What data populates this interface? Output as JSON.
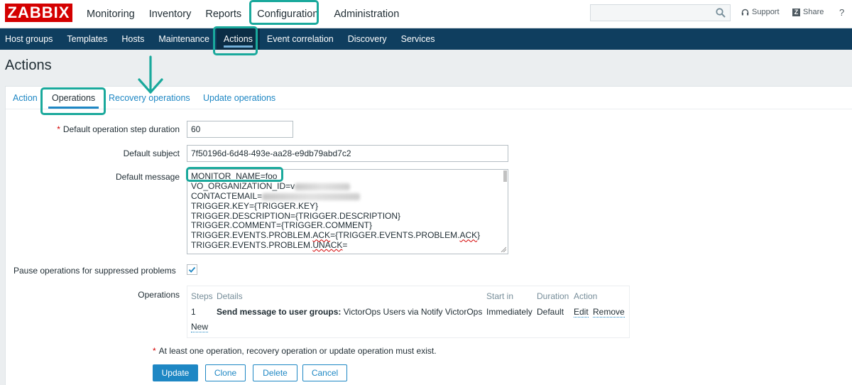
{
  "app": {
    "logo": "ZABBIX"
  },
  "topnav": {
    "items": [
      {
        "label": "Monitoring"
      },
      {
        "label": "Inventory"
      },
      {
        "label": "Reports"
      },
      {
        "label": "Configuration"
      },
      {
        "label": "Administration"
      }
    ],
    "active": "Configuration",
    "search_value": "",
    "support": "Support",
    "share": "Share",
    "help": "?"
  },
  "subnav": {
    "items": [
      {
        "label": "Host groups"
      },
      {
        "label": "Templates"
      },
      {
        "label": "Hosts"
      },
      {
        "label": "Maintenance"
      },
      {
        "label": "Actions"
      },
      {
        "label": "Event correlation"
      },
      {
        "label": "Discovery"
      },
      {
        "label": "Services"
      }
    ],
    "active": "Actions"
  },
  "page": {
    "title": "Actions"
  },
  "tabs": [
    {
      "label": "Action"
    },
    {
      "label": "Operations"
    },
    {
      "label": "Recovery operations"
    },
    {
      "label": "Update operations"
    }
  ],
  "form": {
    "step_duration_label": "Default operation step duration",
    "step_duration_value": "60",
    "subject_label": "Default subject",
    "subject_value": "7f50196d-6d48-493e-aa28-e9db79abd7c2",
    "message_label": "Default message",
    "message_lines": [
      "MONITOR_NAME=foo",
      "VO_ORGANIZATION_ID=v",
      "CONTACTEMAIL=",
      "TRIGGER.KEY={TRIGGER.KEY}",
      "TRIGGER.DESCRIPTION={TRIGGER.DESCRIPTION}",
      "TRIGGER.COMMENT={TRIGGER.COMMENT}",
      "TRIGGER.EVENTS.PROBLEM.ACK={TRIGGER.EVENTS.PROBLEM.ACK}",
      "TRIGGER.EVENTS.PROBLEM.UNACK="
    ],
    "pause_label": "Pause operations for suppressed problems",
    "pause_checked": true,
    "operations_label": "Operations"
  },
  "operations_table": {
    "headers": {
      "steps": "Steps",
      "details": "Details",
      "start_in": "Start in",
      "duration": "Duration",
      "action": "Action"
    },
    "row": {
      "step": "1",
      "details_bold": "Send message to user groups:",
      "details_rest": "VictorOps Users via Notify VictorOps",
      "start_in": "Immediately",
      "duration": "Default",
      "edit": "Edit",
      "remove": "Remove"
    },
    "new_link": "New"
  },
  "note": {
    "star": "*",
    "text": "At least one operation, recovery operation or update operation must exist."
  },
  "buttons": {
    "update": "Update",
    "clone": "Clone",
    "delete": "Delete",
    "cancel": "Cancel"
  },
  "colors": {
    "brand": "#d40000",
    "nav_dark": "#0f3e5f",
    "link": "#1e87c4",
    "highlight": "#1aa99c"
  },
  "icons": {
    "search": "search-icon",
    "support": "headset-icon",
    "share": "share-icon",
    "checkbox": "checkmark-icon"
  }
}
